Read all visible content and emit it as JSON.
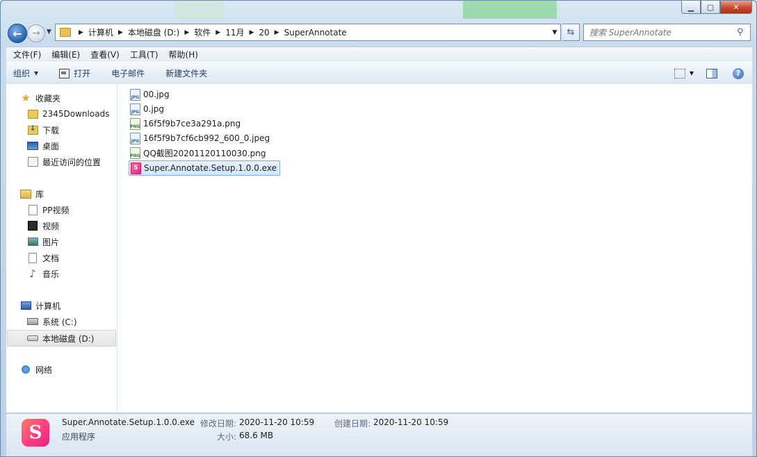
{
  "window": {
    "controls": {
      "minimize": "▁",
      "maximize": "▢",
      "close": "✕"
    }
  },
  "nav": {
    "breadcrumb": [
      "计算机",
      "本地磁盘 (D:)",
      "软件",
      "11月",
      "20",
      "SuperAnnotate"
    ],
    "search_placeholder": "搜索 SuperAnnotate"
  },
  "menu": [
    "文件(F)",
    "编辑(E)",
    "查看(V)",
    "工具(T)",
    "帮助(H)"
  ],
  "toolbar": {
    "organize": "组织",
    "open": "打开",
    "email": "电子邮件",
    "new_folder": "新建文件夹"
  },
  "sidebar": {
    "favorites": {
      "label": "收藏夹",
      "items": [
        "2345Downloads",
        "下载",
        "桌面",
        "最近访问的位置"
      ]
    },
    "libraries": {
      "label": "库",
      "items": [
        "PP视频",
        "视频",
        "图片",
        "文档",
        "音乐"
      ]
    },
    "computer": {
      "label": "计算机",
      "items": [
        "系统 (C:)",
        "本地磁盘 (D:)"
      ],
      "selected": "本地磁盘 (D:)"
    },
    "network": {
      "label": "网络"
    }
  },
  "files": [
    {
      "name": "00.jpg",
      "type": "jpg"
    },
    {
      "name": "0.jpg",
      "type": "jpg"
    },
    {
      "name": "16f5f9b7ce3a291a.png",
      "type": "png"
    },
    {
      "name": "16f5f9b7cf6cb992_600_0.jpeg",
      "type": "jpg"
    },
    {
      "name": "QQ截图20201120110030.png",
      "type": "png"
    },
    {
      "name": "Super.Annotate.Setup.1.0.0.exe",
      "type": "exe",
      "selected": true
    }
  ],
  "details": {
    "filename": "Super.Annotate.Setup.1.0.0.exe",
    "filetype": "应用程序",
    "modified_label": "修改日期:",
    "modified_value": "2020-11-20 10:59",
    "created_label": "创建日期:",
    "created_value": "2020-11-20 10:59",
    "size_label": "大小:",
    "size_value": "68.6 MB",
    "icon_letter": "S"
  },
  "colors": {
    "accent": "#2a63b0",
    "selection": "#d3e6fa",
    "app_icon": "#ff3d7f"
  }
}
